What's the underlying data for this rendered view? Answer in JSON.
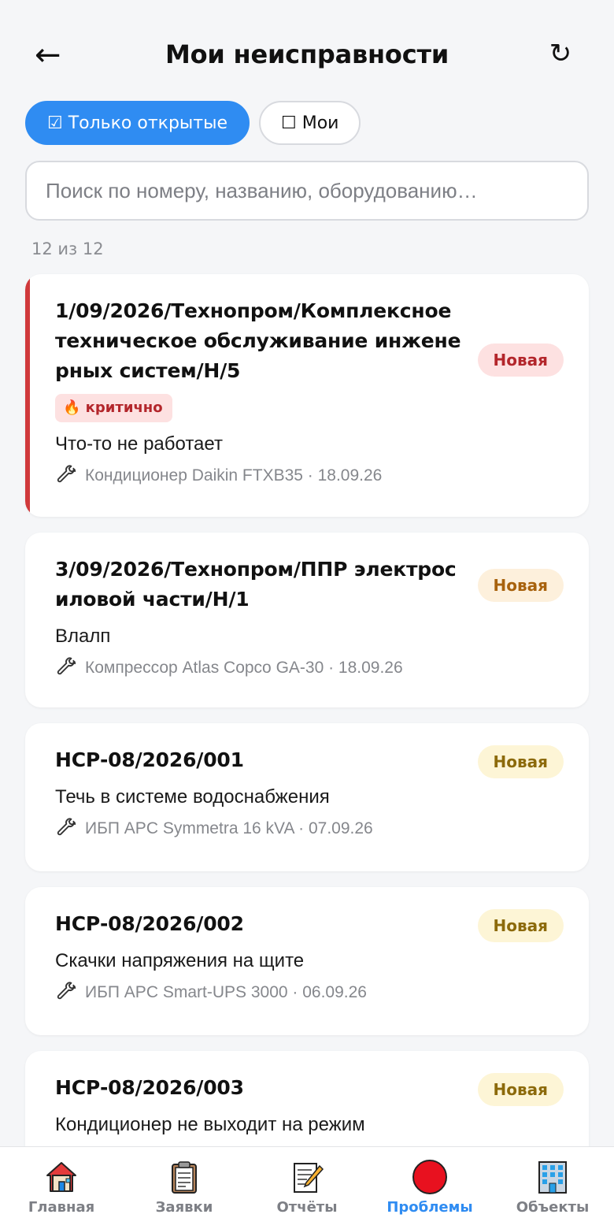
{
  "header": {
    "back_icon": "←",
    "title": "Мои неисправности",
    "refresh_icon": "↻"
  },
  "filters": {
    "open_only": {
      "label": "☑ Только открытые",
      "active": true
    },
    "mine": {
      "label": "☐ Мои",
      "active": false
    }
  },
  "search": {
    "placeholder": "Поиск по номеру, названию, оборудованию…",
    "value": ""
  },
  "counter": "12 из 12",
  "issues": [
    {
      "number": "1/09/2026/Технопром/Комплексное техническое обслуживание инженерных систем/Н/5",
      "status": "Новая",
      "status_color": "red",
      "priority": "🔥 критично",
      "description": "Что-то не работает",
      "meta": "Кондиционер Daikin FTXB35 · 18.09.26"
    },
    {
      "number": "3/09/2026/Технопром/ППР электросиловой части/Н/1",
      "status": "Новая",
      "status_color": "orange",
      "description": "Влалп",
      "meta": "Компрессор Atlas Copco GA-30 · 18.09.26"
    },
    {
      "number": "НСР-08/2026/001",
      "status": "Новая",
      "status_color": "yellow",
      "description": "Течь в системе водоснабжения",
      "meta": "ИБП APC Symmetra 16 kVA · 07.09.26"
    },
    {
      "number": "НСР-08/2026/002",
      "status": "Новая",
      "status_color": "yellow",
      "description": "Скачки напряжения на щите",
      "meta": "ИБП APC Smart-UPS 3000 · 06.09.26"
    },
    {
      "number": "НСР-08/2026/003",
      "status": "Новая",
      "status_color": "yellow",
      "description": "Кондиционер не выходит на режим"
    }
  ],
  "nav": [
    {
      "label": "Главная",
      "icon": "house-icon"
    },
    {
      "label": "Заявки",
      "icon": "clipboard-icon"
    },
    {
      "label": "Отчёты",
      "icon": "memo-icon"
    },
    {
      "label": "Проблемы",
      "icon": "red-circle-icon",
      "active": true
    },
    {
      "label": "Объекты",
      "icon": "office-building-icon"
    }
  ],
  "colors": {
    "accent": "#2f8cf2",
    "critical": "#d0393b",
    "background": "#f5f6f8"
  }
}
